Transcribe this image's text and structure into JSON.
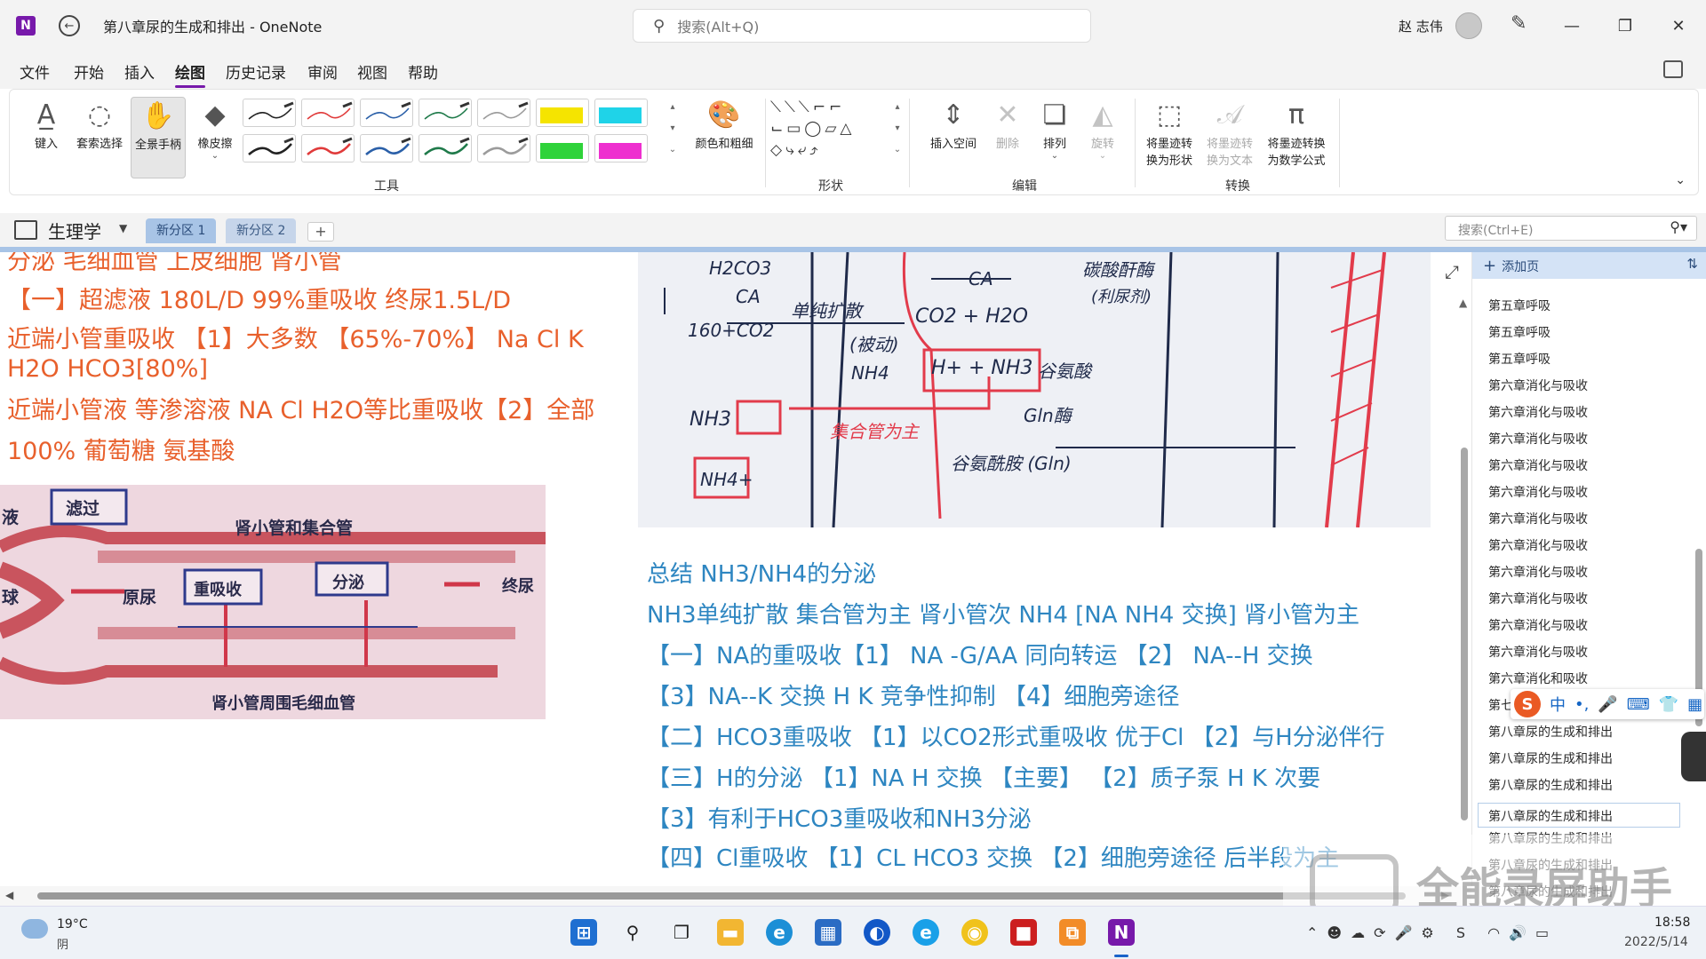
{
  "window": {
    "title": "第八章尿的生成和排出 - OneNote",
    "search_placeholder": "搜索(Alt+Q)",
    "user_name": "赵 志伟",
    "logo_letter": "N"
  },
  "menu": [
    "文件",
    "开始",
    "插入",
    "绘图",
    "历史记录",
    "审阅",
    "视图",
    "帮助"
  ],
  "menu_active": "绘图",
  "ribbon": {
    "tools": [
      {
        "label": "键入",
        "icon": "type-cursor-icon"
      },
      {
        "label": "套索选择",
        "icon": "lasso-icon"
      },
      {
        "label": "全景手柄",
        "icon": "hand-icon",
        "selected": true
      },
      {
        "label": "橡皮擦",
        "icon": "eraser-icon"
      }
    ],
    "pens_top": [
      "#222222",
      "#e03a3a",
      "#2a5fa8",
      "#1f7a4a",
      "#9b9b9b",
      "#f5e400",
      "#1fd3e8"
    ],
    "pens_bottom": [
      "#222222",
      "#e03a3a",
      "#2a5fa8",
      "#1f7a4a",
      "#9b9b9b",
      "#2fd33a",
      "#ee2fcf"
    ],
    "color_button": "颜色和粗细",
    "tools_group": "工具",
    "shapes_group": "形状",
    "edit_buttons": [
      {
        "label": "插入空间",
        "icon": "insert-space-icon",
        "disabled": false
      },
      {
        "label": "删除",
        "icon": "delete-icon",
        "disabled": true
      },
      {
        "label": "排列",
        "icon": "arrange-icon",
        "disabled": false
      },
      {
        "label": "旋转",
        "icon": "rotate-icon",
        "disabled": true
      }
    ],
    "edit_group": "编辑",
    "convert_buttons": [
      {
        "label1": "将墨迹转",
        "label2": "换为形状",
        "disabled": false
      },
      {
        "label1": "将墨迹转",
        "label2": "换为文本",
        "disabled": true
      },
      {
        "label1": "将墨迹转换",
        "label2": "为数学公式",
        "disabled": false
      }
    ],
    "convert_group": "转换"
  },
  "notebook": {
    "name": "生理学",
    "sections": [
      "新分区 1",
      "新分区 2"
    ],
    "add_section": "+",
    "page_search_placeholder": "搜索(Ctrl+E)"
  },
  "left_text": [
    "分泌   毛细血管  上皮细胞  肾小管",
    "【一】超滤液 180L/D   99%重吸收 终尿1.5L/D",
    "近端小管重吸收 【1】大多数 【65%-70%】 Na Cl K",
    "H2O HCO3[80%]",
    "近端小管液 等渗溶液  NA Cl H2O等比重吸收【2】全部",
    "100% 葡萄糖 氨基酸"
  ],
  "diagram": {
    "title": "肾小管和集合管",
    "box_filter": "滤过",
    "box_reabsorb": "重吸收",
    "box_secrete": "分泌",
    "label_primary": "原尿",
    "label_final": "终尿",
    "label_bottom": "肾小管周围毛细血管",
    "label_left1": "液",
    "label_left2": "球"
  },
  "board": {
    "t1": "H2CO3",
    "t2": "CA",
    "t3": "160+CO2",
    "t4": "单纯扩散",
    "t5": "(被动)",
    "t6": "CO2 + H2O",
    "t7": "NH4",
    "t8": "H+ + NH3",
    "t9": "谷氨酸",
    "t10": "NH3",
    "t11": "NH4+",
    "t12": "集合管为主",
    "t13": "Gln酶",
    "t14": "谷氨酰胺 (Gln)",
    "t15": "CA",
    "t16": "碳酸酐酶",
    "t17": "(利尿剂)"
  },
  "right_text": [
    "总结  NH3/NH4的分泌",
    "NH3单纯扩散 集合管为主 肾小管次   NH4 [NA  NH4 交换] 肾小管为主",
    "【一】NA的重吸收【1】  NA -G/AA 同向转运  【2】 NA--H 交换",
    "【3】NA--K 交换  H  K  竞争性抑制  【4】细胞旁途径",
    "【二】HCO3重吸收 【1】以CO2形式重吸收 优于Cl 【2】与H分泌伴行",
    "【三】H的分泌  【1】NA  H  交换 【主要】  【2】质子泵 H  K 次要",
    "【3】有利于HCO3重吸收和NH3分泌",
    "【四】Cl重吸收 【1】CL  HCO3 交换  【2】细胞旁途径  后半段为主"
  ],
  "pages": {
    "add_label": "添加页",
    "items": [
      "第五章呼吸",
      "第五章呼吸",
      "第五章呼吸",
      "第六章消化与吸收",
      "第六章消化与吸收",
      "第六章消化与吸收",
      "第六章消化与吸收",
      "第六章消化与吸收",
      "第六章消化与吸收",
      "第六章消化与吸收",
      "第六章消化与吸收",
      "第六章消化与吸收",
      "第六章消化与吸收",
      "第六章消化与吸收",
      "第六章消化和吸收",
      "第七",
      "第八章尿的生成和排出",
      "第八章尿的生成和排出",
      "第八章尿的生成和排出",
      "第八章尿的生成和排出",
      "第八章尿的生成和排出",
      "第八章尿的生成和排出",
      "第八章尿的生成和排出"
    ],
    "selected_index": 19
  },
  "ime": {
    "logo": "S",
    "lang": "中",
    "punct": "•,"
  },
  "watermark": "全能录屏助手",
  "taskbar": {
    "temp": "19°C",
    "weather": "阴",
    "time": "18:58",
    "date": "2022/5/14"
  }
}
